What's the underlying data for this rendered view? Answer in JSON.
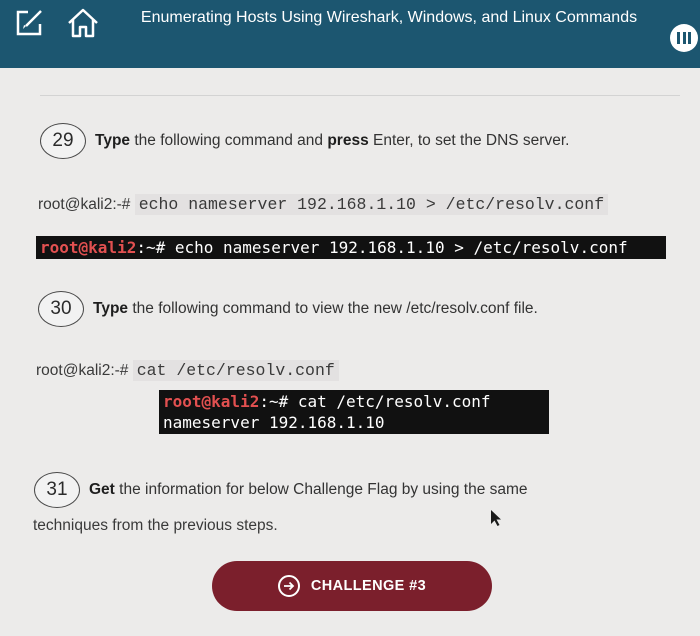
{
  "header": {
    "title": "Enumerating Hosts Using Wireshark, Windows, and Linux Commands",
    "icons": [
      "edit-icon",
      "home-icon",
      "menu-icon"
    ]
  },
  "steps": [
    {
      "number": "29",
      "text_bold1": "Type",
      "text_mid": " the following command and ",
      "text_bold2": "press",
      "text_end": " Enter, to set the DNS server.",
      "prompt": "root@kali2:-# ",
      "command": "echo nameserver 192.168.1.10 > /etc/resolv.conf",
      "terminal": {
        "root": "root",
        "host": "@kali2",
        "rest": ":~# echo nameserver 192.168.1.10 > /etc/resolv.conf"
      }
    },
    {
      "number": "30",
      "text_bold1": "Type",
      "text_end": " the following command to view the new /etc/resolv.conf file.",
      "prompt": "root@kali2:-# ",
      "command": "cat /etc/resolv.conf",
      "terminal": {
        "root": "root",
        "host": "@kali2",
        "rest": ":~# cat /etc/resolv.conf",
        "output": "nameserver 192.168.1.10"
      }
    },
    {
      "number": "31",
      "text_bold1": "Get",
      "text_end": " the information for below Challenge Flag by using the same",
      "text_line2": "techniques from the previous steps."
    }
  ],
  "challenge_button": {
    "label": "CHALLENGE #3"
  },
  "colors": {
    "header": "#1c5670",
    "button": "#7b1f2c",
    "terminal_bg": "#111111",
    "prompt_red": "#e25050"
  }
}
